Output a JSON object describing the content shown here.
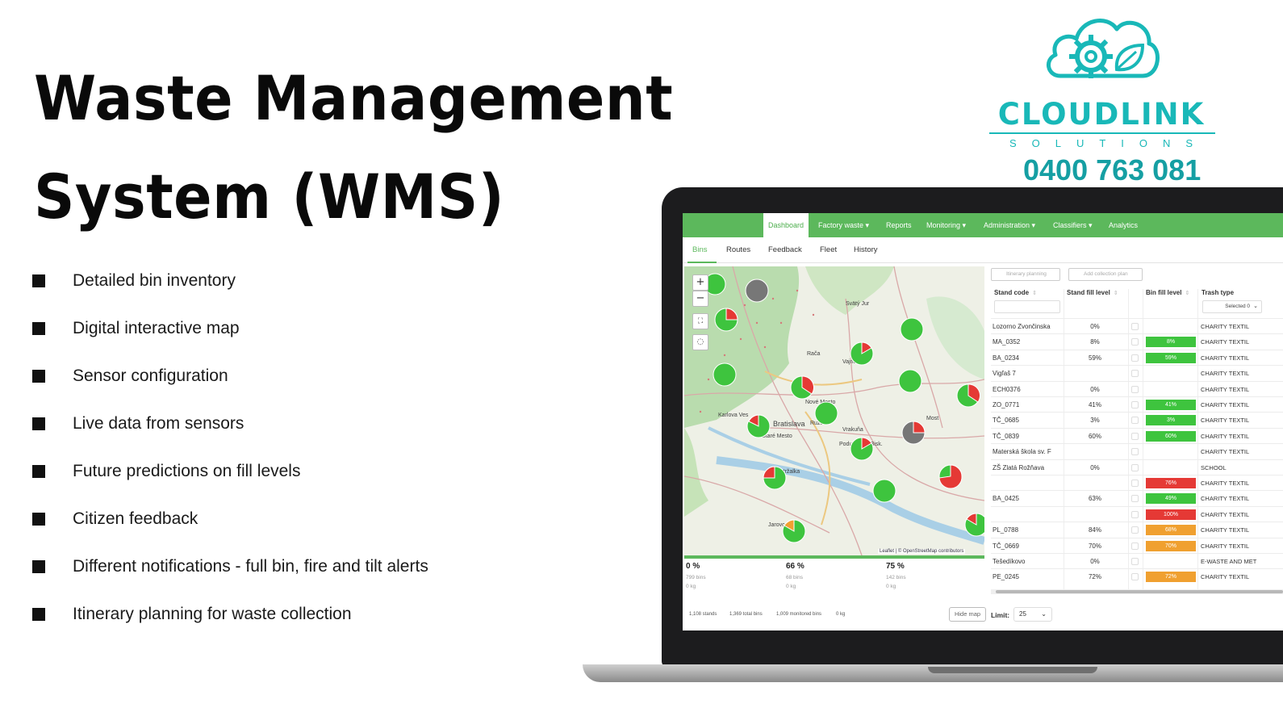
{
  "headline": {
    "line1": "Waste Management",
    "line2": "System (WMS)"
  },
  "features": [
    "Detailed bin inventory",
    "Digital interactive map",
    "Sensor configuration",
    "Live data from sensors",
    "Future predictions on fill levels",
    "Citizen feedback",
    "Different notifications - full bin, fire and tilt alerts",
    "Itinerary planning for waste collection"
  ],
  "brand": {
    "name": "CLOUDLINK",
    "sub": "SOLUTIONS",
    "phone": "0400 763 081",
    "color": "#19b8b8"
  },
  "app": {
    "nav": [
      "Dashboard",
      "Factory waste ▾",
      "Reports",
      "Monitoring ▾",
      "Administration ▾",
      "Classifiers ▾",
      "Analytics"
    ],
    "subtabs": [
      "Bins",
      "Routes",
      "Feedback",
      "Fleet",
      "History"
    ],
    "map": {
      "zoom_in": "+",
      "zoom_out": "−",
      "attribution": "Leaflet | © OpenStreetMap contributors",
      "places": [
        "Svätý Jur",
        "Rača",
        "Vajnory",
        "Karlova Ves",
        "Bratislava",
        "Staré Mesto",
        "Nové Mesto",
        "Ružinov",
        "Vrakuňa",
        "Podunajské Biskupice",
        "Petržalka",
        "Jarovce",
        "Most pri Bratislave"
      ]
    },
    "stats": [
      {
        "pct": "0 %",
        "bins": "799 bins",
        "kg": "0 kg"
      },
      {
        "pct": "66 %",
        "bins": "68 bins",
        "kg": "0 kg"
      },
      {
        "pct": "75 %",
        "bins": "142 bins",
        "kg": "0 kg"
      }
    ],
    "footer": {
      "stands": "1,108 stands",
      "total_bins": "1,369 total bins",
      "monitored": "1,009 monitored bins",
      "kg": "0 kg"
    },
    "hide_map": "Hide map",
    "limit_label": "Limit:",
    "limit_value": "25",
    "buttons": {
      "itinerary": "Itinerary planning",
      "add_plan": "Add collection plan"
    },
    "columns": {
      "code": "Stand code",
      "stand_fill": "Stand fill level",
      "bin_fill": "Bin fill level",
      "type": "Trash type"
    },
    "selected_filter": "Selected 0",
    "rows": [
      {
        "code": "Lozorno Zvončinska",
        "stand": "0%",
        "fill": "",
        "type": "CHARITY TEXTIL"
      },
      {
        "code": "MA_0352",
        "stand": "8%",
        "fill": "8%",
        "type": "CHARITY TEXTIL"
      },
      {
        "code": "BA_0234",
        "stand": "59%",
        "fill": "59%",
        "type": "CHARITY TEXTIL"
      },
      {
        "code": "Vigľaš 7",
        "stand": "",
        "fill": "",
        "type": "CHARITY TEXTIL"
      },
      {
        "code": "ECH0376",
        "stand": "0%",
        "fill": "",
        "type": "CHARITY TEXTIL"
      },
      {
        "code": "ZO_0771",
        "stand": "41%",
        "fill": "41%",
        "type": "CHARITY TEXTIL"
      },
      {
        "code": "TČ_0685",
        "stand": "3%",
        "fill": "3%",
        "type": "CHARITY TEXTIL"
      },
      {
        "code": "TČ_0839",
        "stand": "60%",
        "fill": "60%",
        "type": "CHARITY TEXTIL"
      },
      {
        "code": "Materská škola sv. F",
        "stand": "",
        "fill": "",
        "type": "CHARITY TEXTIL"
      },
      {
        "code": "ZŠ Zlatá Rožňava",
        "stand": "0%",
        "fill": "",
        "type": "SCHOOL"
      },
      {
        "code": "",
        "stand": "",
        "fill": "76%",
        "type": "CHARITY TEXTIL"
      },
      {
        "code": "BA_0425",
        "stand": "63%",
        "fill": "49%",
        "type": "CHARITY TEXTIL"
      },
      {
        "code": "",
        "stand": "",
        "fill": "100%",
        "type": "CHARITY TEXTIL"
      },
      {
        "code": "PL_0788",
        "stand": "84%",
        "fill": "68%",
        "type": "CHARITY TEXTIL"
      },
      {
        "code": "TČ_0669",
        "stand": "70%",
        "fill": "70%",
        "type": "CHARITY TEXTIL"
      },
      {
        "code": "Tešedíkovo",
        "stand": "0%",
        "fill": "",
        "type": "E-WASTE AND MET"
      },
      {
        "code": "PE_0245",
        "stand": "72%",
        "fill": "72%",
        "type": "CHARITY TEXTIL"
      }
    ],
    "fill_colors": {
      "low": "#3ec43e",
      "mid": "#f0a030",
      "high": "#e53935"
    }
  }
}
